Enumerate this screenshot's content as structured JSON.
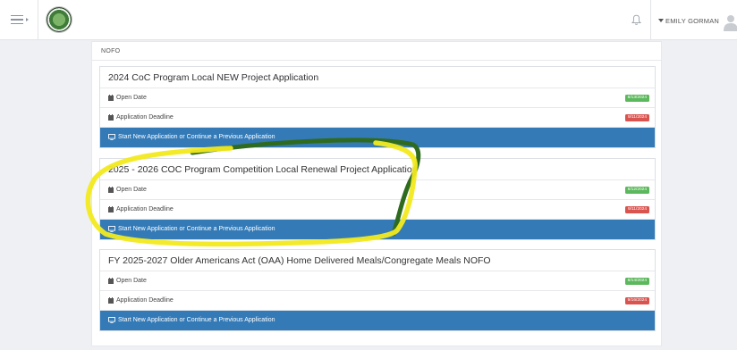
{
  "header": {
    "user_name": "EMILY GORMAN",
    "icons": [
      "menu-icon",
      "organization-logo",
      "bell-icon",
      "user-avatar-icon"
    ]
  },
  "section": {
    "label": "NOFO"
  },
  "cards": [
    {
      "title": "2024 CoC Program Local NEW Project Application",
      "open_label": "Open Date",
      "open_date": "8/13/2024",
      "deadline_label": "Application Deadline",
      "deadline_date": "9/11/2024",
      "action_label": "Start New Application or Continue a Previous Application"
    },
    {
      "title": "2025 - 2026 COC Program Competition Local Renewal Project Application",
      "open_label": "Open Date",
      "open_date": "8/12/2024",
      "deadline_label": "Application Deadline",
      "deadline_date": "9/11/2024",
      "action_label": "Start New Application or Continue a Previous Application"
    },
    {
      "title": "FY 2025-2027 Older Americans Act (OAA) Home Delivered Meals/Congregate Meals NOFO",
      "open_label": "Open Date",
      "open_date": "8/14/2024",
      "deadline_label": "Application Deadline",
      "deadline_date": "9/16/2024",
      "action_label": "Start New Application or Continue a Previous Application"
    }
  ],
  "colors": {
    "primary_blue": "#337ab7",
    "badge_green": "#5cb85c",
    "badge_red": "#d9534f",
    "highlight_yellow": "#f2ea1f",
    "highlight_green": "#2f6b1f"
  }
}
